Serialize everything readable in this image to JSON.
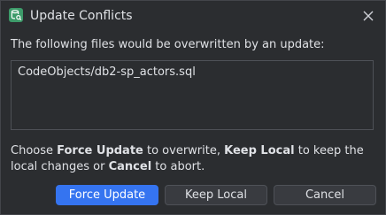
{
  "window": {
    "title": "Update Conflicts",
    "icon": "database-search-icon",
    "close_icon": "close-icon"
  },
  "intro_text": "The following files would be overwritten by an update:",
  "files": [
    "CodeObjects/db2-sp_actors.sql"
  ],
  "instructions": {
    "prefix": "Choose ",
    "force_bold": "Force Update",
    "mid1": " to overwrite, ",
    "keep_bold": "Keep Local",
    "mid2": " to keep the local changes or ",
    "cancel_bold": "Cancel",
    "suffix": " to abort."
  },
  "buttons": {
    "force_update": "Force Update",
    "keep_local": "Keep Local",
    "cancel": "Cancel"
  },
  "colors": {
    "primary": "#3574f0",
    "background": "#2b2d30",
    "icon_green": "#3d9b6a"
  }
}
